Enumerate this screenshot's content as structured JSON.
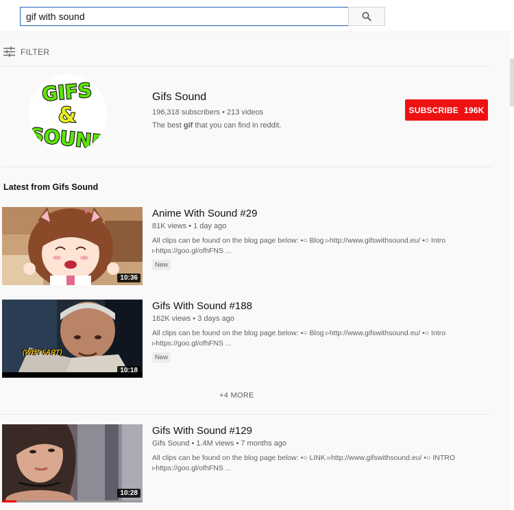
{
  "search": {
    "value": "gif with sound"
  },
  "filter": {
    "label": "FILTER"
  },
  "channel": {
    "name": "Gifs Sound",
    "stats": "196,318 subscribers • 213 videos",
    "desc_before": "The best ",
    "desc_highlight": "gif",
    "desc_after": " that you can find in reddit.",
    "logo_lines": [
      "GIFS",
      "&",
      "SOUND"
    ],
    "subscribe_label": "SUBSCRIBE",
    "subscribe_count": "196K"
  },
  "latest": {
    "title": "Latest from Gifs Sound",
    "videos": [
      {
        "title": "Anime With Sound #29",
        "meta": "81K views • 1 day ago",
        "desc1": "All clips can be found on the blog page below: •○ Blog ▹http://www.gifswithsound.eu/ •○ Intro",
        "desc2": "▹https://goo.gl/ofhFNS ...",
        "badge": "New",
        "duration": "10:36"
      },
      {
        "title": "Gifs With Sound #188",
        "meta": "162K views • 3 days ago",
        "desc1": "All clips can be found on the blog page below: •○ Blog ▹http://www.gifswithsound.eu/ •○ Intro",
        "desc2": "▹https://goo.gl/ofhFNS ...",
        "badge": "New",
        "duration": "10:18",
        "caption": "(WET FART)"
      }
    ],
    "more_label": "+4 MORE"
  },
  "results": [
    {
      "title": "Gifs With Sound #129",
      "meta": "Gifs Sound • 1.4M views • 7 months ago",
      "desc1": "All clips can be found on the blog page below: •○ LINK ▹http://www.gifswithsound.eu/ •○ INTRO",
      "desc2": "▹https://goo.gl/ofhFNS ...",
      "duration": "10:28",
      "watched_fraction": 0.1
    }
  ],
  "colors": {
    "accent": "#ee1111",
    "search_border": "#1c62b9",
    "logo_green": "#5fe40b"
  }
}
